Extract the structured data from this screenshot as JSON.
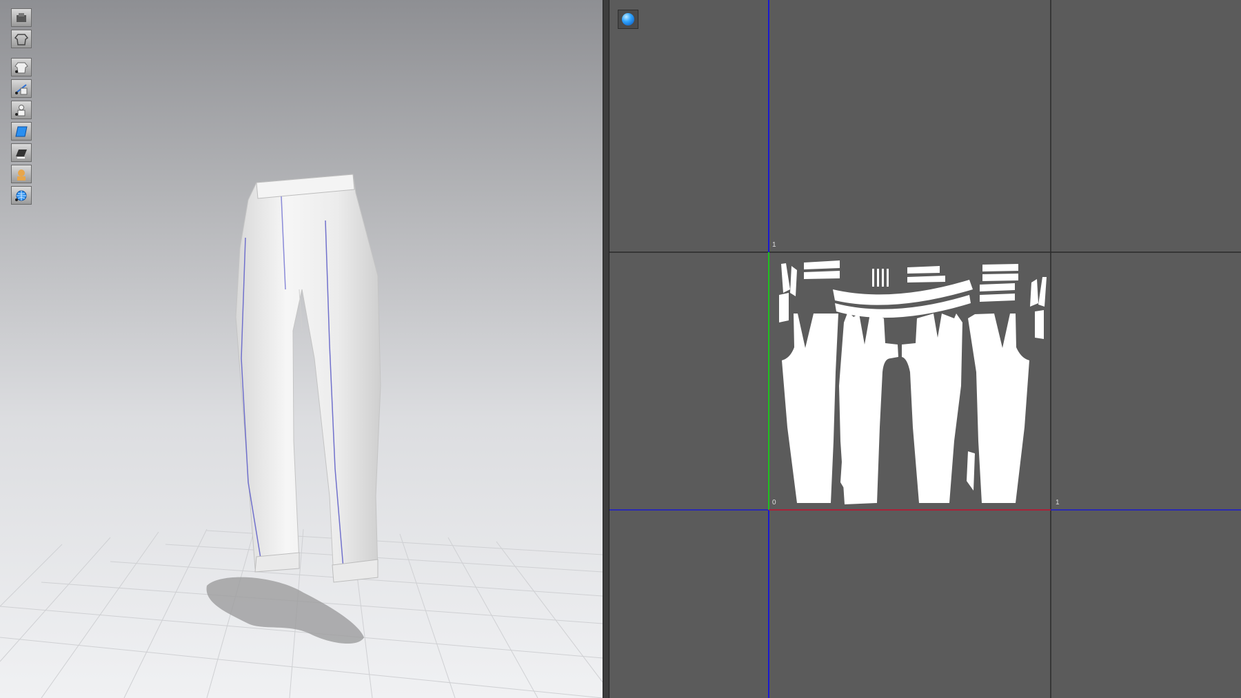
{
  "viewport_3d": {
    "toolbar": {
      "groups": [
        [
          "avatar-display-icon",
          "garment-display-icon"
        ],
        [
          "show-garment-icon",
          "show-measurements-icon",
          "show-avatar-icon",
          "texture-view-icon",
          "render-view-icon",
          "avatar-skin-icon",
          "environment-icon"
        ]
      ]
    },
    "garment": "white trousers"
  },
  "viewport_2d": {
    "render_button": "render-sphere-icon",
    "axis_labels": {
      "top": "1",
      "origin": "0",
      "right": "1"
    },
    "colors": {
      "background": "#5b5b5b",
      "grid": "#2b2b2b",
      "axis_blue": "#1a1ad0",
      "axis_red": "#d01a1a",
      "axis_green": "#20c020",
      "pieces": "#ffffff"
    }
  }
}
